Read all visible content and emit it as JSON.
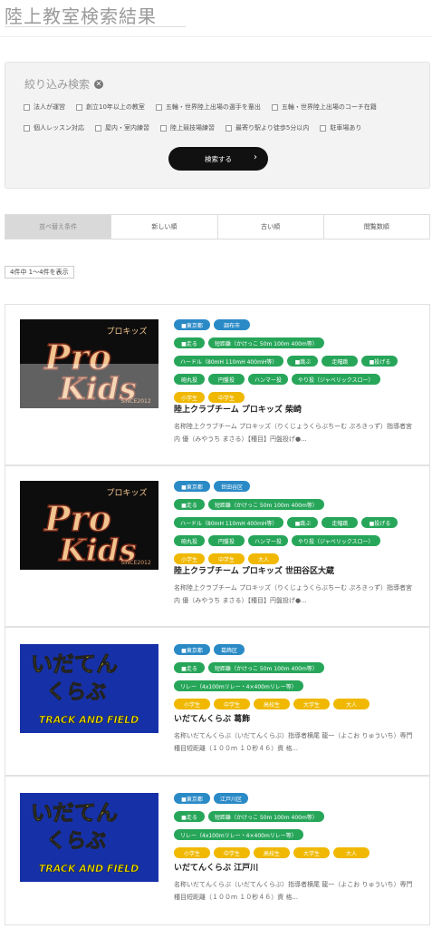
{
  "page": {
    "title": "陸上教室検索結果"
  },
  "filter": {
    "heading": "絞り込み検索",
    "row1": [
      "法人が運営",
      "創立10年以上の教室",
      "五輪・世界陸上出場の選手を輩出",
      "五輪・世界陸上出場のコーチ在籍"
    ],
    "row2": [
      "個人レッスン対応",
      "屋内・室内練習",
      "陸上競技場練習",
      "最寄り駅より徒歩5分以内",
      "駐車場あり"
    ],
    "search_label": "検索する"
  },
  "sort": {
    "options": [
      "並べ替え条件",
      "新しい順",
      "古い順",
      "閲覧数順"
    ]
  },
  "results": {
    "count_text": "4件中 1〜4件を表示",
    "items": [
      {
        "tags_blue": [
          "■東京都",
          "調布市"
        ],
        "tags_green_1": [
          "■走る",
          "短距離（かけっこ 50m 100m 400m等）"
        ],
        "tags_green_2": [
          "ハードル（80mH 110mH 400mH等）",
          "■跳ぶ",
          "走幅跳",
          "■投げる"
        ],
        "tags_green_3": [
          "砲丸投",
          "円盤投",
          "ハンマー投",
          "やり投（ジャベリックスロー）"
        ],
        "tags_yellow": [
          "小学生",
          "中学生"
        ],
        "title": "陸上クラブチーム プロキッズ 柴崎",
        "desc": "名称陸上クラブチーム プロキッズ（りくじょうくらぶちーむ ぷろきっず）指導者宮内 優（みやうち まさる）【種目】円盤投げ●...",
        "logo": {
          "kana": "プロキッズ",
          "line1": "Pro",
          "line2": "Kids",
          "since": "SINCE2012"
        }
      },
      {
        "tags_blue": [
          "■東京都",
          "世田谷区"
        ],
        "tags_green_1": [
          "■走る",
          "短距離（かけっこ 50m 100m 400m等）"
        ],
        "tags_green_2": [
          "ハードル（80mH 110mH 400mH等）",
          "■跳ぶ",
          "走幅跳",
          "■投げる"
        ],
        "tags_green_3": [
          "砲丸投",
          "円盤投",
          "ハンマー投",
          "やり投（ジャベリックスロー）"
        ],
        "tags_yellow": [
          "小学生",
          "中学生",
          "大人"
        ],
        "title": "陸上クラブチーム プロキッズ 世田谷区大蔵",
        "desc": "名称陸上クラブチーム プロキッズ（りくじょうくらぶちーむ ぷろきっず）指導者宮内 優（みやうち まさる）【種目】円盤投げ●...",
        "logo": {
          "kana": "プロキッズ",
          "line1": "Pro",
          "line2": "Kids",
          "since": "SINCE2012"
        }
      },
      {
        "tags_blue": [
          "■東京都",
          "葛飾区"
        ],
        "tags_green_1": [
          "■走る",
          "短距離（かけっこ 50m 100m 400m等）"
        ],
        "tags_green_2": [
          "リレー（4x100mリレー・4×400mリレー等）"
        ],
        "tags_yellow": [
          "小学生",
          "中学生",
          "高校生",
          "大学生",
          "大人"
        ],
        "title": "いだてんくらぶ 葛飾",
        "desc": "名称いだてんくらぶ（いだてんくらぶ）指導者横尾 龍一（よこお りゅういち）専門種目短距離（１００ｍ １０秒４６）資 格...",
        "logo": {
          "line1": "いだてん",
          "line2": "くらぶ",
          "line3": "TRACK AND FIELD"
        }
      },
      {
        "tags_blue": [
          "■東京都",
          "江戸川区"
        ],
        "tags_green_1": [
          "■走る",
          "短距離（かけっこ 50m 100m 400m等）"
        ],
        "tags_green_2": [
          "リレー（4x100mリレー・4×400mリレー等）"
        ],
        "tags_yellow": [
          "小学生",
          "中学生",
          "高校生",
          "大学生",
          "大人"
        ],
        "title": "いだてんくらぶ 江戸川",
        "desc": "名称いだてんくらぶ（いだてんくらぶ）指導者横尾 龍一（よこお りゅういち）専門種目短距離（１００ｍ １０秒４６）資 格...",
        "logo": {
          "line1": "いだてん",
          "line2": "くらぶ",
          "line3": "TRACK AND FIELD"
        }
      }
    ]
  },
  "colors": {
    "area_tag": "#2a8ac6",
    "event_tag": "#27a65a",
    "age_tag": "#f0b800",
    "search_button": "#111111"
  }
}
